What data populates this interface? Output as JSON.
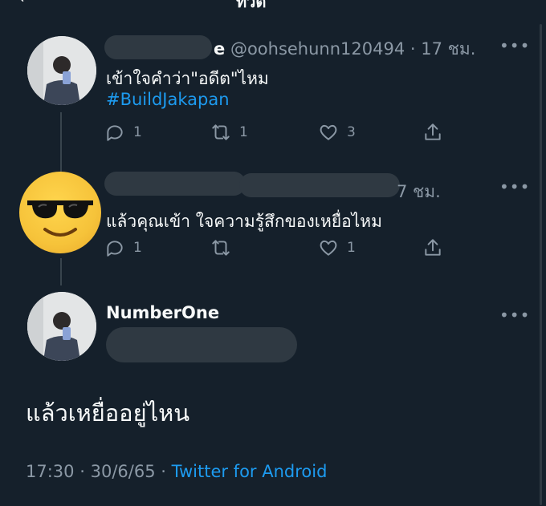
{
  "header": {
    "title": "ทวีต"
  },
  "tweets": [
    {
      "handle_suffix": "e",
      "handle": "@oohsehunn120494",
      "dot": "·",
      "time": "17 ชม.",
      "text": "เข้าใจคำว่า\"อดีต\"ไหม",
      "hashtag": "#BuildJakapan",
      "replies": "1",
      "retweets": "1",
      "likes": "3"
    },
    {
      "time": "7 ชม.",
      "text": "แล้วคุณเข้า ใจความรู้สึกของเหยื่อไหม",
      "replies": "1",
      "retweets": "",
      "likes": "1"
    }
  ],
  "main": {
    "name": "NumberOne",
    "text": "แล้วเหยื่ออยู่ไหน",
    "time": "17:30",
    "sep1": "·",
    "date": "30/6/65",
    "sep2": "·",
    "source": "Twitter for Android"
  },
  "icons": {
    "reply": "reply-icon",
    "retweet": "retweet-icon",
    "like": "heart-icon",
    "share": "share-icon",
    "more": "more-icon",
    "emoji": "sunglasses-emoji-icon"
  },
  "colors": {
    "background": "#15202b",
    "text": "#f7f9f9",
    "secondary": "#8b98a5",
    "accent": "#1d9bf0"
  }
}
